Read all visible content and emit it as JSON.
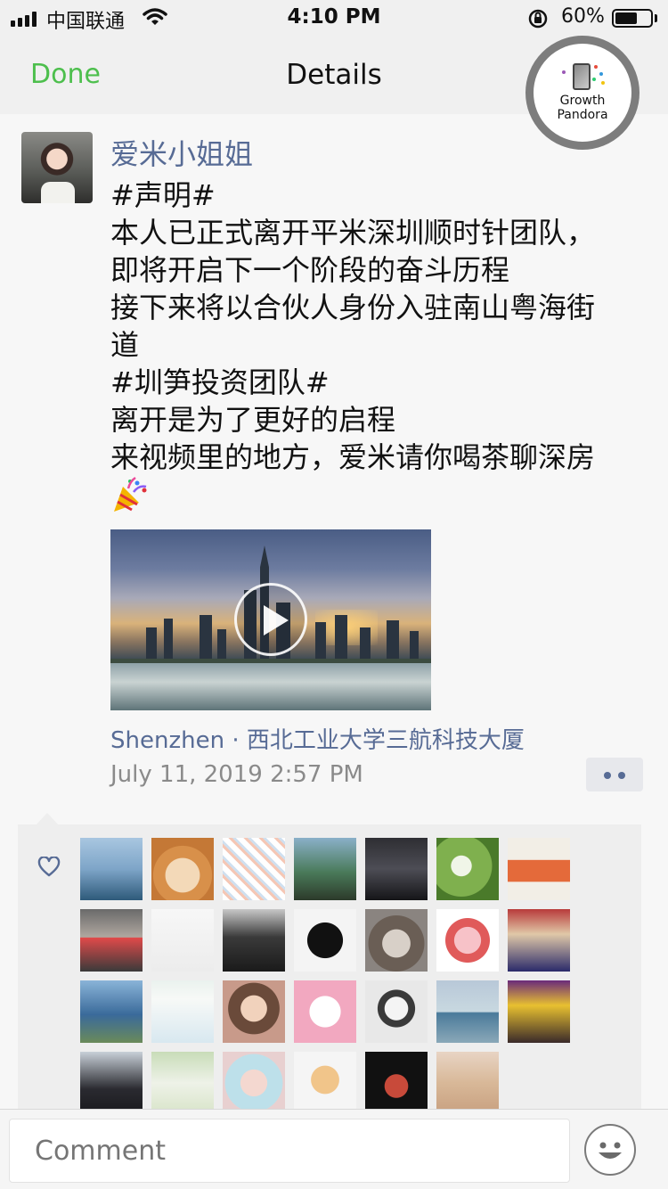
{
  "status_bar": {
    "carrier": "中国联通",
    "time": "4:10 PM",
    "battery": "60%"
  },
  "nav": {
    "done": "Done",
    "title": "Details"
  },
  "watermark": {
    "line1": "Growth",
    "line2": "Pandora"
  },
  "post": {
    "username": "爱米小姐姐",
    "lines": [
      "#声明#",
      "本人已正式离开平米深圳顺时针团队，",
      "即将开启下一个阶段的奋斗历程",
      "接下来将以合伙人身份入驻南山粤海街",
      "道",
      "#圳笋投资团队#",
      "离开是为了更好的启程",
      "来视频里的地方，爱米请你喝茶聊深房"
    ],
    "emoji_icon": "party-popper-icon",
    "location": "Shenzhen · 西北工业大学三航科技大厦",
    "timestamp": "July 11, 2019 2:57 PM"
  },
  "likes": {
    "icon": "heart-icon"
  },
  "comment": {
    "placeholder": "Comment"
  },
  "colors": {
    "accent_green": "#4dbf4d",
    "link_blue": "#576b95",
    "meta_gray": "#8a8a8a"
  }
}
